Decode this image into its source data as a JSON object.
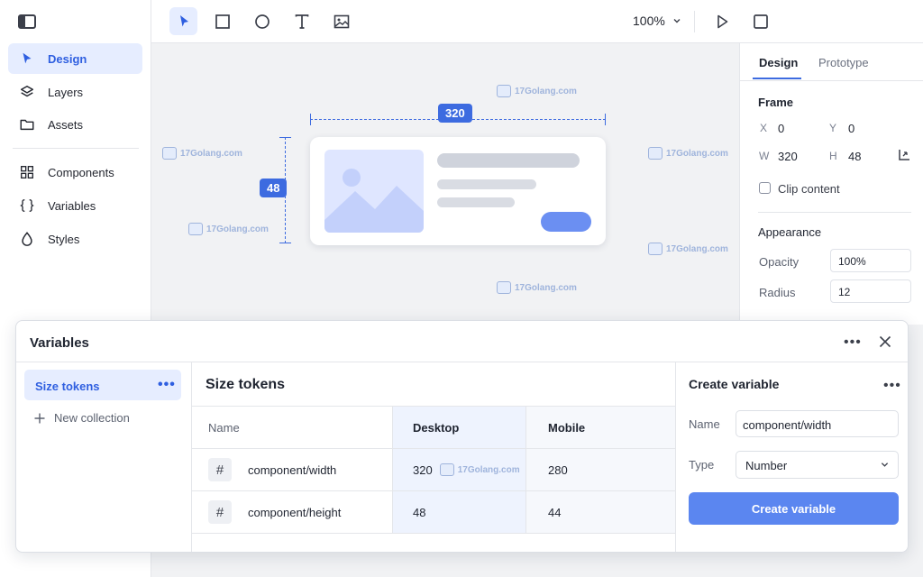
{
  "sidebar": {
    "items": [
      {
        "label": "Design",
        "icon": "cursor-icon",
        "active": true
      },
      {
        "label": "Layers",
        "icon": "layers-icon"
      },
      {
        "label": "Assets",
        "icon": "folder-icon"
      },
      {
        "label": "Components",
        "icon": "grid-icon"
      },
      {
        "label": "Variables",
        "icon": "braces-icon"
      },
      {
        "label": "Styles",
        "icon": "drop-icon"
      }
    ]
  },
  "toolbar": {
    "zoom": "100%"
  },
  "canvas": {
    "width_label": "320",
    "height_label": "48",
    "watermark": "17Golang.com"
  },
  "design_panel": {
    "tabs": [
      "Design",
      "Prototype"
    ],
    "frame_title": "Frame",
    "x_label": "X",
    "x_value": "0",
    "y_label": "Y",
    "y_value": "0",
    "w_label": "W",
    "w_value": "320",
    "h_label": "H",
    "h_value": "48",
    "clip_label": "Clip content",
    "appearance_title": "Appearance",
    "opacity_label": "Opacity",
    "opacity_value": "100%",
    "radius_label": "Radius",
    "radius_value": "12"
  },
  "variables_modal": {
    "title": "Variables",
    "collection": "Size tokens",
    "new_collection": "New collection",
    "table_title": "Size tokens",
    "columns": [
      "Name",
      "Desktop",
      "Mobile"
    ],
    "rows": [
      {
        "name": "component/width",
        "desktop": "320",
        "mobile": "280"
      },
      {
        "name": "component/height",
        "desktop": "48",
        "mobile": "44"
      }
    ],
    "create": {
      "title": "Create variable",
      "name_label": "Name",
      "name_value": "component/width",
      "type_label": "Type",
      "type_value": "Number",
      "button": "Create variable"
    }
  },
  "colors": {
    "accent": "#3d6be0",
    "active_bg": "#e6edff",
    "button": "#5b86f0"
  }
}
